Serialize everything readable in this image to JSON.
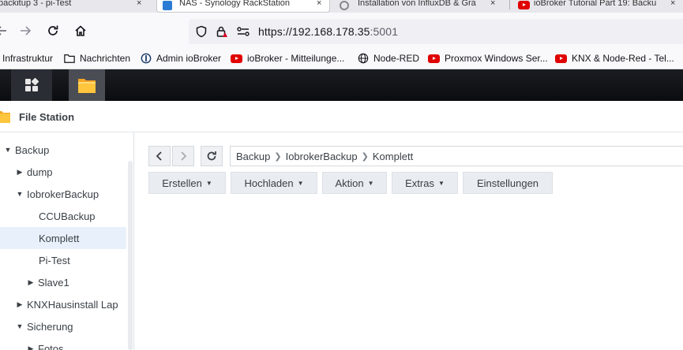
{
  "browser": {
    "tabs": [
      {
        "title": "backitup 3 - pi-Test",
        "close": "×"
      },
      {
        "title": "NAS - Synology RackStation",
        "close": "×"
      },
      {
        "title": "Installation von InfluxDB & Gra",
        "close": "×"
      },
      {
        "title": "ioBroker Tutorial Part 19: Backu",
        "close": "×"
      }
    ],
    "url_host": "https://192.168.178.35",
    "url_port": ":5001",
    "bookmarks": [
      {
        "label": "Infrastruktur",
        "icon": "none"
      },
      {
        "label": "Nachrichten",
        "icon": "folder-icon"
      },
      {
        "label": "Admin ioBroker",
        "icon": "iobroker-icon"
      },
      {
        "label": "ioBroker - Mitteilunge...",
        "icon": "youtube-icon"
      },
      {
        "label": "Node-RED",
        "icon": "globe-icon"
      },
      {
        "label": "Proxmox Windows Ser...",
        "icon": "youtube-icon"
      },
      {
        "label": "KNX & Node-Red - Tel...",
        "icon": "youtube-icon"
      }
    ]
  },
  "window": {
    "title": "File Station"
  },
  "tree": [
    {
      "label": "Backup",
      "caret": "down"
    },
    {
      "label": "dump",
      "caret": "right"
    },
    {
      "label": "IobrokerBackup",
      "caret": "down"
    },
    {
      "label": "CCUBackup",
      "caret": "none"
    },
    {
      "label": "Komplett",
      "caret": "none",
      "selected": true
    },
    {
      "label": "Pi-Test",
      "caret": "none"
    },
    {
      "label": "Slave1",
      "caret": "right"
    },
    {
      "label": "KNXHausinstall Lap",
      "caret": "right"
    },
    {
      "label": "Sicherung",
      "caret": "down"
    },
    {
      "label": "Fotos",
      "caret": "right"
    }
  ],
  "path": [
    "Backup",
    "IobrokerBackup",
    "Komplett"
  ],
  "toolbar": {
    "create": "Erstellen",
    "upload": "Hochladen",
    "action": "Aktion",
    "extras": "Extras",
    "settings": "Einstellungen"
  },
  "colors": {
    "accent": "#0086e5",
    "selected_bg": "#e8f1fb",
    "taskbar": "#0b0c0f"
  }
}
